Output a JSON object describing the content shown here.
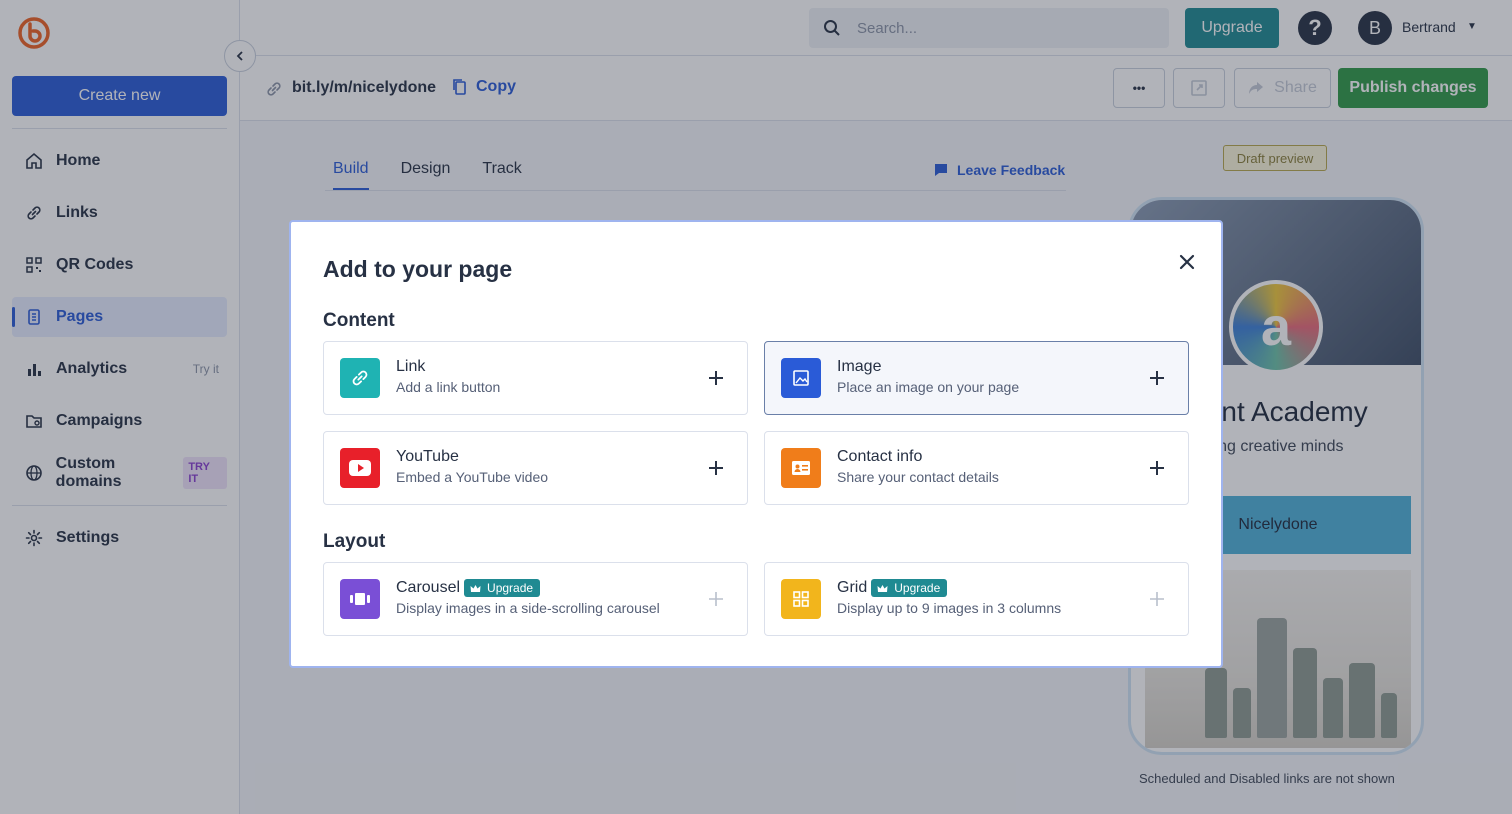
{
  "sidebar": {
    "create_label": "Create new",
    "items": [
      {
        "label": "Home"
      },
      {
        "label": "Links"
      },
      {
        "label": "QR Codes"
      },
      {
        "label": "Pages"
      },
      {
        "label": "Analytics",
        "tag": "Try it"
      },
      {
        "label": "Campaigns"
      },
      {
        "label": "Custom domains",
        "badge": "TRY IT"
      },
      {
        "label": "Settings"
      }
    ]
  },
  "topbar": {
    "search_placeholder": "Search...",
    "upgrade_label": "Upgrade",
    "help_glyph": "?",
    "avatar_initial": "B",
    "username": "Bertrand"
  },
  "subbar": {
    "short_link": "bit.ly/m/nicelydone",
    "copy_label": "Copy",
    "more_glyph": "•••",
    "share_label": "Share",
    "publish_label": "Publish changes"
  },
  "main": {
    "tabs": [
      {
        "label": "Build"
      },
      {
        "label": "Design"
      },
      {
        "label": "Track"
      }
    ],
    "feedback_label": "Leave Feedback",
    "draft_label": "Draft preview"
  },
  "preview": {
    "logo_letter": "a",
    "title": "nont Academy",
    "subtitle": "ing creative minds",
    "link_button": "Nicelydone",
    "note": "Scheduled and Disabled links are not shown"
  },
  "modal": {
    "title": "Add to your page",
    "sections": {
      "content": "Content",
      "layout": "Layout"
    },
    "cards": [
      {
        "title": "Link",
        "desc": "Add a link button",
        "color": "#1fb3b3"
      },
      {
        "title": "Image",
        "desc": "Place an image on your page",
        "color": "#2a5bd7"
      },
      {
        "title": "YouTube",
        "desc": "Embed a YouTube video",
        "color": "#e8202a"
      },
      {
        "title": "Contact info",
        "desc": "Share your contact details",
        "color": "#f07d1a"
      },
      {
        "title": "Carousel",
        "desc": "Display images in a side-scrolling carousel",
        "color": "#7a4fd6",
        "badge": "Upgrade"
      },
      {
        "title": "Grid",
        "desc": "Display up to 9 images in 3 columns",
        "color": "#f2b51c",
        "badge": "Upgrade"
      }
    ]
  },
  "icons": {
    "logo": "bitly-logo-icon",
    "search": "search-icon",
    "close": "close-icon",
    "plus": "plus-icon",
    "crown": "crown-icon"
  },
  "colors": {
    "primary": "#2a5bd7",
    "upgrade": "#1f8a92",
    "publish": "#2f9a47",
    "logo": "#ee6123"
  }
}
